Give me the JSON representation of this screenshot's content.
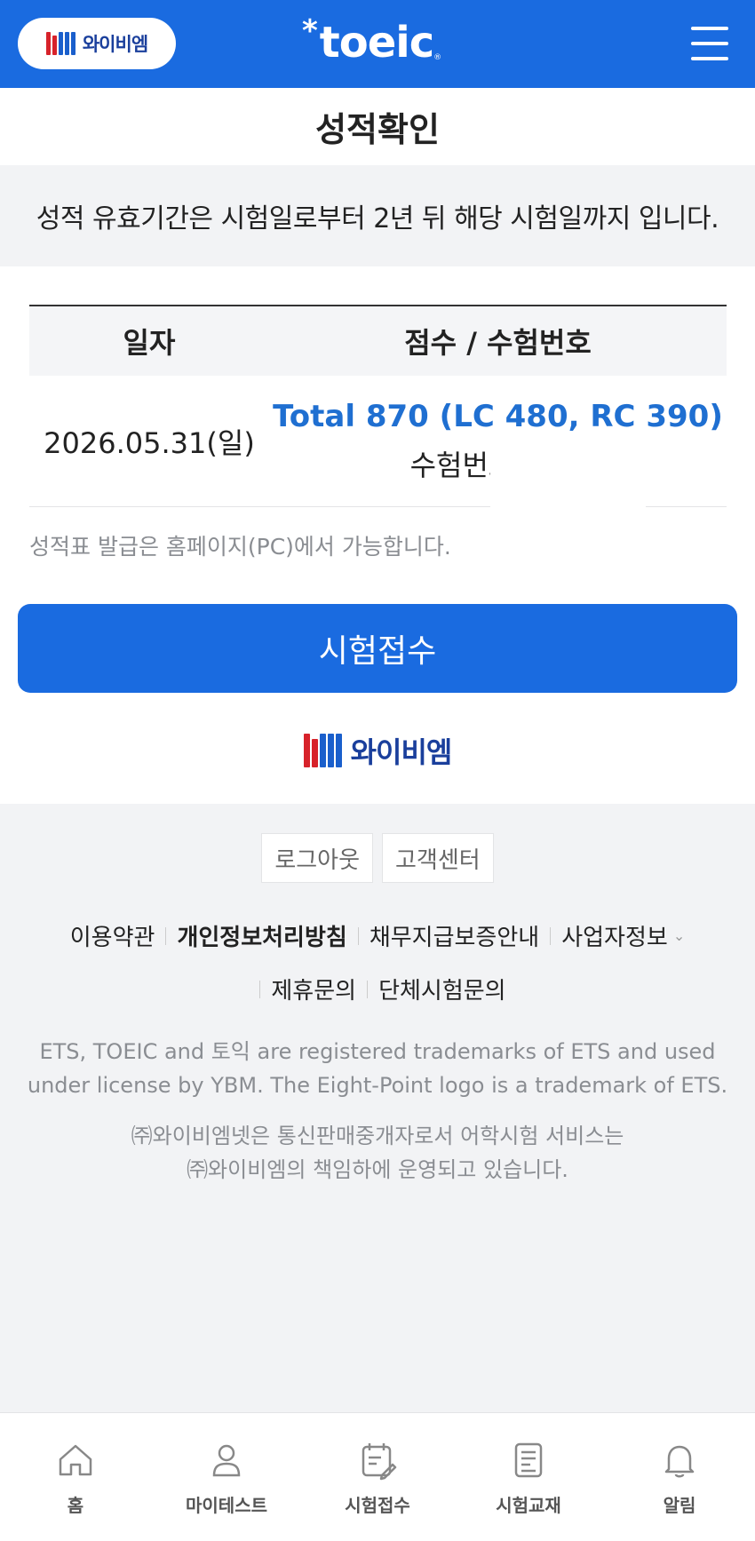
{
  "header": {
    "brand_text": "와이비엠",
    "logo_text": "toeic",
    "logo_star": "*",
    "logo_reg": "®",
    "menu_icon": "hamburger-menu-icon"
  },
  "title": "성적확인",
  "notice": "성적 유효기간은 시험일로부터 2년 뒤 해당 시험일까지 입니다.",
  "table": {
    "headers": [
      "일자",
      "점수 / 수험번호"
    ],
    "rows": [
      {
        "date": "2026.05.31(일)",
        "score": "Total 870 (LC 480, RC 390)",
        "exam_no_label": "수험번호"
      }
    ]
  },
  "print_note": "성적표 발급은 홈페이지(PC)에서 가능합니다.",
  "apply_button": "시험접수",
  "bottom_brand": "와이비엠",
  "footer": {
    "buttons": [
      "로그아웃",
      "고객센터"
    ],
    "links_row1": [
      "이용약관",
      "개인정보처리방침",
      "채무지급보증안내",
      "사업자정보"
    ],
    "links_row2": [
      "제휴문의",
      "단체시험문의"
    ],
    "trademark_lines": [
      "ETS, TOEIC and 토익 are registered trademarks of ETS and used",
      "under license by YBM. The Eight-Point logo is a trademark of ETS."
    ],
    "company_lines": [
      "㈜와이비엠넷은 통신판매중개자로서 어학시험 서비스는",
      "㈜와이비엠의 책임하에 운영되고 있습니다."
    ]
  },
  "bottom_nav": [
    {
      "label": "홈",
      "icon": "home-icon"
    },
    {
      "label": "마이테스트",
      "icon": "user-icon"
    },
    {
      "label": "시험접수",
      "icon": "calendar-edit-icon"
    },
    {
      "label": "시험교재",
      "icon": "book-icon"
    },
    {
      "label": "알림",
      "icon": "bell-icon"
    }
  ],
  "colors": {
    "primary": "#1a6be0",
    "score_blue": "#1f6fd1",
    "ybm_red": "#d7222a"
  }
}
